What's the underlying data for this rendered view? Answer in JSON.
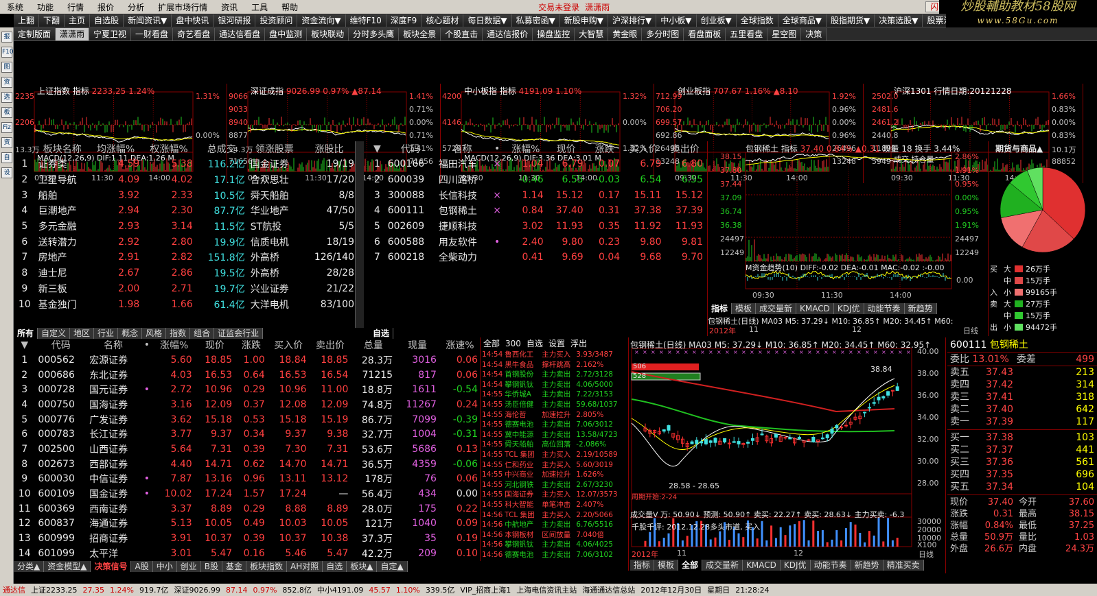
{
  "menu": [
    "系统",
    "功能",
    "行情",
    "报价",
    "分析",
    "扩展市场行情",
    "资讯",
    "工具",
    "帮助"
  ],
  "trade": {
    "login": "交易未登录",
    "user": "潇潇雨",
    "b1": "闪电手",
    "b2": "行 情"
  },
  "logo": {
    "title": "炒股輔助教材58股网",
    "url": "www.58Gu.com"
  },
  "toolbar1": [
    "上翻",
    "下翻",
    "主页",
    "自选股",
    "新闻资讯▼",
    "盘中快讯",
    "银河研报",
    "投资顾问",
    "资金流向▼",
    "维特F10",
    "深度F9",
    "核心题材",
    "每日数据▼",
    "私募密函▼",
    "新股申购▼",
    "沪深排行▼",
    "中小板▼",
    "创业板▼",
    "全球指数",
    "全球商品▼",
    "股指期货▼",
    "决策选股▼",
    "股票池▼",
    "风云"
  ],
  "toolbar2": [
    "定制版面",
    "潇潇雨",
    "宁夏卫视",
    "一财看盘",
    "奇艺看盘",
    "通达信看盘",
    "盘中监测",
    "板块联动",
    "分时多头鹰",
    "板块全景",
    "个股直击",
    "通达信报价",
    "操盘监控",
    "大智慧",
    "黄金眼",
    "多分时图",
    "看盘面板",
    "五里看盘",
    "星空图",
    "决策"
  ],
  "leftIcons": [
    "报",
    "F10",
    "图",
    "资",
    "选",
    "板",
    "Fiz",
    "资",
    "自",
    "设"
  ],
  "minis": [
    {
      "name": "上证指数",
      "sub": "指标",
      "val": "2233.25",
      "pct": "1.24%",
      "yl": [
        "2235",
        "2206",
        "13.3万"
      ],
      "yr": [
        "1.31%",
        "0.00%"
      ],
      "ind": "MACD(12,26,9)  DIF:1.11  DEA:1.26 M",
      "times": [
        "09:30",
        "11:30",
        "14:00"
      ]
    },
    {
      "name": "深证成指",
      "sub": "",
      "val": "9026.99",
      "pct": "0.97%",
      "chg": "▲87.14",
      "yl": [
        "9066",
        "9033",
        "8940",
        "8877",
        "14.3万",
        "71656"
      ],
      "yr": [
        "1.41%",
        "0.71%",
        "0.00%",
        "0.71%",
        "1.41%",
        "71656"
      ],
      "times": [
        "09:30",
        "11:30",
        "14:00"
      ]
    },
    {
      "name": "中小板指",
      "sub": "指标",
      "val": "4191.09",
      "pct": "1.10%",
      "yl": [
        "4200",
        "4146",
        "57297"
      ],
      "yr": [
        "1.32%",
        "0.00%",
        "1.32%"
      ],
      "ind": "MACD(12,26,9)  DIF:3.36  DEA:3.01  M",
      "times": [
        "09:30",
        "11:30",
        "14:00"
      ]
    },
    {
      "name": "创业板指",
      "sub": "",
      "val": "707.67",
      "pct": "1.16%",
      "chg": "▲8.10",
      "yl": [
        "712.99",
        "706.20",
        "699.57",
        "692.86",
        "26496",
        "13248"
      ],
      "yr": [
        "1.92%",
        "0.96%",
        "0.00%",
        "0.96%",
        "26496",
        "13248"
      ],
      "times": [
        "09:30",
        "11:30",
        "14:00"
      ]
    },
    {
      "name": "沪深1301",
      "sub": "行情日期:20121228",
      "val": "",
      "pct": "",
      "yl": [
        "2502.0",
        "2481.6",
        "2461.2",
        "2440.8",
        "11898",
        "5949"
      ],
      "yr": [
        "1.66%",
        "0.83%",
        "0.00%",
        "0.83%",
        "10.1万",
        "88852"
      ],
      "ind": "成交 持仓量",
      "times": [
        "09:30",
        "11:30",
        "14:00"
      ]
    }
  ],
  "sector": {
    "headers": [
      "板块名称",
      "均涨幅%",
      "权涨幅%",
      "总成交",
      "领涨股票",
      "涨股比"
    ],
    "rows": [
      [
        "1",
        "证券类",
        "4.59",
        "5.38",
        "116.2亿",
        "国金证券",
        "19/19"
      ],
      [
        "2",
        "卫星导航",
        "4.09",
        "4.02",
        "17.1亿",
        "合众思壮",
        "17/20"
      ],
      [
        "3",
        "船舶",
        "3.92",
        "2.33",
        "10.5亿",
        "舜天船舶",
        "8/8"
      ],
      [
        "4",
        "巨潮地产",
        "2.94",
        "2.30",
        "87.7亿",
        "华业地产",
        "47/50"
      ],
      [
        "5",
        "多元金融",
        "2.93",
        "3.14",
        "11.5亿",
        "ST航投",
        "5/5"
      ],
      [
        "6",
        "送转潜力",
        "2.92",
        "2.80",
        "19.9亿",
        "信质电机",
        "18/19"
      ],
      [
        "7",
        "房地产",
        "2.91",
        "2.82",
        "151.8亿",
        "外高桥",
        "126/140"
      ],
      [
        "8",
        "迪士尼",
        "2.67",
        "2.86",
        "19.5亿",
        "外高桥",
        "28/28"
      ],
      [
        "9",
        "新三板",
        "2.00",
        "2.71",
        "19.7亿",
        "兴业证券",
        "21/22"
      ],
      [
        "10",
        "基金独门",
        "1.98",
        "1.66",
        "61.4亿",
        "大洋电机",
        "83/100"
      ]
    ],
    "tabs": [
      "所有",
      "自定义",
      "地区",
      "行业",
      "概念",
      "风格",
      "指数",
      "组合",
      "证监会行业"
    ]
  },
  "watch": {
    "headers": [
      "代码",
      "名称",
      "•",
      "涨幅%",
      "现价",
      "涨跌",
      "买入价",
      "卖出价"
    ],
    "rows": [
      [
        "1",
        "600166",
        "福田汽车",
        "×",
        "1.04",
        "6.79",
        "0.07",
        "6.79",
        "6.80"
      ],
      [
        "2",
        "600039",
        "四川路桥",
        "",
        "-0.46",
        "6.55",
        "-0.03",
        "6.54",
        "6.55"
      ],
      [
        "3",
        "300088",
        "长信科技",
        "×",
        "1.14",
        "15.12",
        "0.17",
        "15.11",
        "15.12"
      ],
      [
        "4",
        "600111",
        "包钢稀土",
        "×",
        "0.84",
        "37.40",
        "0.31",
        "37.38",
        "37.39"
      ],
      [
        "5",
        "002609",
        "捷顺科技",
        "",
        "3.02",
        "11.93",
        "0.35",
        "11.92",
        "11.93"
      ],
      [
        "6",
        "600588",
        "用友软件",
        "•",
        "2.40",
        "9.80",
        "0.23",
        "9.80",
        "9.81"
      ],
      [
        "7",
        "600218",
        "全柴动力",
        "",
        "0.41",
        "9.69",
        "0.04",
        "9.68",
        "9.70"
      ]
    ],
    "tab": "自选"
  },
  "intraday": {
    "title": "包钢稀土  指标",
    "price": "37.40",
    "pct": "0.84%",
    "chg": "▲0.31",
    "vol": "现量 18",
    "turn": "换手 3.44%",
    "yl": [
      "38.15",
      "37.80",
      "37.44",
      "37.09",
      "36.74",
      "36.38",
      "24497",
      "12249"
    ],
    "yr": [
      "2.86%",
      "1.91%",
      "0.95%",
      "0.00%",
      "0.95%",
      "1.91%",
      "24497",
      "12249"
    ],
    "ind": "M资金趋势(10)  DIFF:-0.02  DEA:-0.01  MAC:-0.02  :-0.00",
    "indr": "0.00",
    "times": [
      "09:30",
      "11:30",
      "14:00"
    ],
    "tabs": [
      "指标",
      "模板",
      "成交量新",
      "KMACD",
      "KDJ优",
      "动能节奏",
      "新趋势"
    ],
    "kline": "包钢稀土(日线) MA03  M5: 37.29↓  M10: 36.85↑  M20: 34.45↑  M60:",
    "month": "2012年",
    "m11": "11",
    "m12": "12",
    "rixian": "日线"
  },
  "pie": {
    "title": "期货与商品▲",
    "rows": [
      [
        "买",
        "大",
        "26万手"
      ],
      [
        "",
        "中",
        "15万手"
      ],
      [
        "入",
        "小",
        "99165手"
      ],
      [
        "卖",
        "大",
        "27万手"
      ],
      [
        "",
        "中",
        "15万手"
      ],
      [
        "出",
        "小",
        "94472手"
      ]
    ],
    "colors": [
      "#e03030",
      "#e04848",
      "#f07070",
      "#20b020",
      "#30c830",
      "#60e060"
    ],
    "shares": [
      0.37,
      0.21,
      0.14,
      0.14,
      0.08,
      0.06
    ]
  },
  "stocks": {
    "headers": [
      "代码",
      "名称",
      "•",
      "涨幅%",
      "现价",
      "涨跌",
      "买入价",
      "卖出价",
      "总量",
      "现量",
      "涨速%"
    ],
    "rows": [
      [
        "1",
        "000562",
        "宏源证券",
        "",
        "5.60",
        "18.85",
        "1.00",
        "18.84",
        "18.85",
        "28.3万",
        "3016",
        "0.06"
      ],
      [
        "2",
        "000686",
        "东北证券",
        "",
        "4.03",
        "16.53",
        "0.64",
        "16.53",
        "16.54",
        "71215",
        "817",
        "0.06"
      ],
      [
        "3",
        "000728",
        "国元证券",
        "•",
        "2.72",
        "10.96",
        "0.29",
        "10.96",
        "11.00",
        "18.8万",
        "1611",
        "-0.54"
      ],
      [
        "4",
        "000750",
        "国海证券",
        "",
        "3.16",
        "12.09",
        "0.37",
        "12.08",
        "12.09",
        "74.8万",
        "11267",
        "0.24"
      ],
      [
        "5",
        "000776",
        "广发证券",
        "",
        "3.62",
        "15.18",
        "0.53",
        "15.18",
        "15.19",
        "86.7万",
        "7099",
        "-0.39"
      ],
      [
        "6",
        "000783",
        "长江证券",
        "",
        "3.77",
        "9.37",
        "0.34",
        "9.37",
        "9.38",
        "32.7万",
        "1004",
        "-0.31"
      ],
      [
        "7",
        "002500",
        "山西证券",
        "",
        "5.64",
        "7.31",
        "0.39",
        "7.30",
        "7.31",
        "53.6万",
        "5686",
        "0.13"
      ],
      [
        "8",
        "002673",
        "西部证券",
        "",
        "4.40",
        "14.71",
        "0.62",
        "14.70",
        "14.71",
        "36.5万",
        "4359",
        "-0.06"
      ],
      [
        "9",
        "600030",
        "中信证券",
        "•",
        "7.87",
        "13.16",
        "0.96",
        "13.11",
        "13.12",
        "178万",
        "76",
        "0.06"
      ],
      [
        "10",
        "600109",
        "国金证券",
        "•",
        "10.02",
        "17.24",
        "1.57",
        "17.24",
        "—",
        "56.4万",
        "434",
        "0.00"
      ],
      [
        "11",
        "600369",
        "西南证券",
        "",
        "3.37",
        "8.89",
        "0.29",
        "8.88",
        "8.89",
        "28.0万",
        "175",
        "0.22"
      ],
      [
        "12",
        "600837",
        "海通证券",
        "",
        "5.13",
        "10.05",
        "0.49",
        "10.03",
        "10.05",
        "121万",
        "1040",
        "0.09"
      ],
      [
        "13",
        "600999",
        "招商证券",
        "",
        "3.91",
        "10.37",
        "0.39",
        "10.37",
        "10.38",
        "37.3万",
        "35",
        "0.19"
      ],
      [
        "14",
        "601099",
        "太平洋",
        "",
        "3.01",
        "5.47",
        "0.16",
        "5.46",
        "5.47",
        "42.2万",
        "209",
        "0.10"
      ]
    ],
    "tabs": [
      "分类▲",
      "资金模型▲",
      "决策信号",
      "A股",
      "中小",
      "创业",
      "B股",
      "基金",
      "板块指数",
      "AH对照",
      "自选",
      "板块▲",
      "自定▲"
    ]
  },
  "alerts": {
    "head": [
      "全部",
      "300",
      "自选",
      "设置",
      "浮出"
    ],
    "rows": [
      [
        "14:54",
        "鲁西化工",
        "主力买入",
        "3.93/3487"
      ],
      [
        "14:54",
        "黑牛食品",
        "撑杆跳高",
        "2.162%"
      ],
      [
        "14:54",
        "首钢股份",
        "主力卖出",
        "2.72/3128"
      ],
      [
        "14:54",
        "攀钢钒钛",
        "主力卖出",
        "4.06/5000"
      ],
      [
        "14:55",
        "华侨城A",
        "主力卖出",
        "7.22/3153"
      ],
      [
        "14:55",
        "汤臣倍健",
        "主力卖出",
        "59.68/1037"
      ],
      [
        "14:55",
        "海伦哲",
        "加速拉升",
        "2.805%"
      ],
      [
        "14:55",
        "德赛电池",
        "主力卖出",
        "7.06/3012"
      ],
      [
        "14:55",
        "冀中能源",
        "主力卖出",
        "13.58/4723"
      ],
      [
        "14:55",
        "舜天船舶",
        "高位回落",
        "-2.086%"
      ],
      [
        "14:55",
        "TCL 集团",
        "主力买入",
        "2.19/10589"
      ],
      [
        "14:55",
        "仁和药业",
        "主力买入",
        "5.60/3019"
      ],
      [
        "14:55",
        "中兴商业",
        "加速拉升",
        "1.626%"
      ],
      [
        "14:55",
        "河北钢铁",
        "主力卖出",
        "2.67/3230"
      ],
      [
        "14:55",
        "国海证券",
        "主力买入",
        "12.07/3573"
      ],
      [
        "14:55",
        "科大智能",
        "单笔冲击",
        "2.407%"
      ],
      [
        "14:56",
        "TCL 集团",
        "主力买入",
        "2.20/5066"
      ],
      [
        "14:56",
        "中航地产",
        "主力卖出",
        "6.76/5516"
      ],
      [
        "14:56",
        "本钢板材",
        "区间放量",
        "7.040倍"
      ],
      [
        "14:56",
        "攀钢钒钛",
        "主力卖出",
        "4.06/4025"
      ],
      [
        "14:56",
        "德赛电池",
        "主力卖出",
        "7.06/3102"
      ]
    ]
  },
  "kchart": {
    "title": "包钢稀土(日线) MA03  M5: 37.29↓  M10: 36.85↑  M20: 34.45↑  M60: 32.95↑",
    "b1": "506",
    "b2": "528",
    "hi": "38.84",
    "lo": "28.58 - 28.65",
    "lo2": "周期开始:2-24",
    "yl": [
      "40.00",
      "38.00",
      "36.00",
      "34.00",
      "32.00",
      "30.00",
      "28.00",
      "30000",
      "20000",
      "10000",
      "X100"
    ],
    "vol": "成交量V 万: 50.90↓  预测: 50.90↑  卖买: 22.27↑  卖买: 28.63↓  主力买卖: -6.3",
    "comment": "千股千评: 2012.12.28多头市道, 买入",
    "month": "2012年",
    "m11": "11",
    "m12": "12",
    "rixian": "日线",
    "tabs": [
      "指标",
      "模板",
      "全部",
      "成交量新",
      "KMACD",
      "KDJ优",
      "动能节奏",
      "新趋势",
      "精准买卖"
    ]
  },
  "quote": {
    "code": "600111",
    "name": "包钢稀土",
    "wb": "13.01%",
    "wc": "499",
    "sell": [
      [
        "卖五",
        "37.43",
        "213"
      ],
      [
        "卖四",
        "37.42",
        "314"
      ],
      [
        "卖三",
        "37.41",
        "318"
      ],
      [
        "卖二",
        "37.40",
        "642"
      ],
      [
        "卖一",
        "37.39",
        "117"
      ]
    ],
    "buy": [
      [
        "买一",
        "37.38",
        "103"
      ],
      [
        "买二",
        "37.37",
        "441"
      ],
      [
        "买三",
        "37.36",
        "561"
      ],
      [
        "买四",
        "37.35",
        "696"
      ],
      [
        "买五",
        "37.34",
        "104"
      ]
    ],
    "stats": [
      [
        "现价",
        "37.40",
        "今开",
        "37.60"
      ],
      [
        "涨跌",
        "0.31",
        "最高",
        "38.15"
      ],
      [
        "涨幅",
        "0.84%",
        "最低",
        "37.25"
      ],
      [
        "总量",
        "50.9万",
        "量比",
        "1.03"
      ],
      [
        "外盘",
        "26.6万",
        "内盘",
        "24.3万"
      ]
    ]
  },
  "status": [
    "通达信",
    "上证2233.25",
    "27.35",
    "1.24%",
    "919.7亿",
    "深证9026.99",
    "87.14",
    "0.97%",
    "852.8亿",
    "中小4191.09",
    "45.57",
    "1.10%",
    "339.5亿",
    "VIP_招商上海1",
    "上海电信资讯主站",
    "海通通达信总站",
    "2012年12月30日",
    "星期日",
    "21:28:24"
  ]
}
